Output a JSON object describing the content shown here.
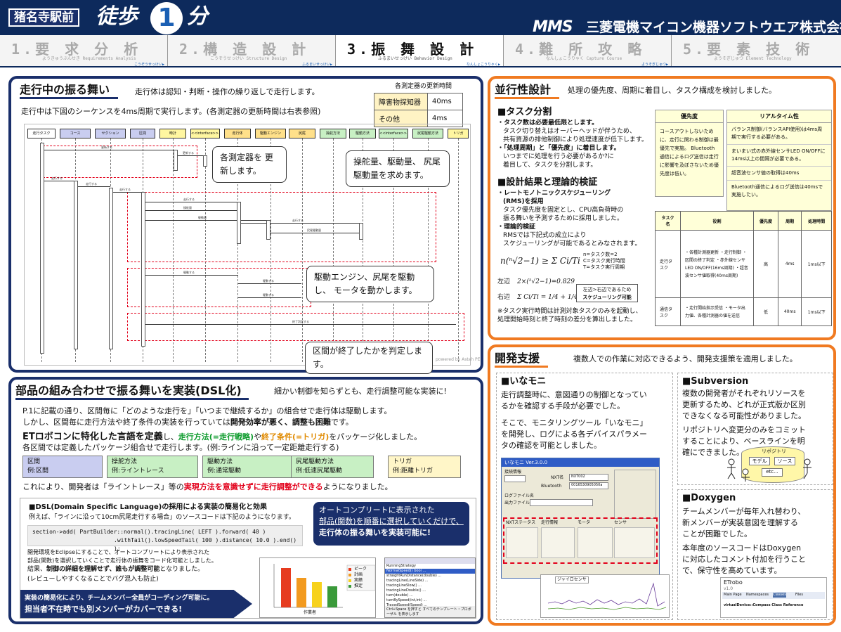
{
  "header": {
    "team": "猪名寺駅前",
    "walk": "徒歩",
    "one": "1",
    "minute": "分",
    "logo": "MMS",
    "company": "三菱電機マイコン機器ソフトウエア株式会社"
  },
  "tabs": [
    {
      "title": "1.要 求 分 析",
      "sub": "ようきゅうぶんせき Requirements Analysis",
      "next": "こうぞうせっけい▶"
    },
    {
      "title": "2.構 造 設 計",
      "sub": "こうぞうせっけい Structure Design",
      "next": "ふるまいせっけい▶"
    },
    {
      "title": "3.振 舞 設 計",
      "sub": "ふるまいせっけい Behavior Design",
      "next": "なんしょこうりゃく▶"
    },
    {
      "title": "4.難 所 攻 略",
      "sub": "なんしょこうりゃく Capture Course",
      "next": "ようそぎじゅつ▶"
    },
    {
      "title": "5.要 素 技 術",
      "sub": "ようそぎじゅつ Element Technology",
      "next": ""
    }
  ],
  "behavior": {
    "title": "走行中の振る舞い",
    "lead": "走行体は認知・判断・操作の繰り返しで走行します。",
    "desc": "走行中は下図のシーケンスを4ms周期で実行します。(各測定器の更新時間は右表参照)",
    "table_title": "各測定器の更新時間",
    "table": [
      [
        "障害物探知器",
        "40ms"
      ],
      [
        "その他",
        "4ms"
      ]
    ],
    "lifelines": [
      "走行タスク",
      "コース",
      "セクション",
      "区間",
      "時計",
      "<<interface>> 測定器",
      "走行体",
      "駆動エンジン",
      "尻尾",
      "操舵方法",
      "駆動方法",
      "<<interface>> 走行書換",
      "尻尾駆動方法",
      "トリガ"
    ],
    "callouts": [
      "各測定器を 更新します。",
      "操舵量、駆動量、 尻尾駆動量を求めます。",
      "駆動エンジン、尻尾を駆動し、 モータを動かします。",
      "区間が終了したかを判定します。"
    ],
    "msgs": [
      "更新する",
      "更新する",
      "走行する",
      "走行する",
      "走行する",
      "走行する",
      "操舵量",
      "駆動量",
      "走行する",
      "尻尾駆動量",
      "駆動する",
      "駆動する",
      "駆動する",
      "終了判定する"
    ],
    "credit": "powered by Astah PE"
  },
  "dsl": {
    "title": "部品の組み合わせで振る舞いを実装(DSL化)",
    "lead": "細かい制御を知らずとも、走行調整可能な実装に!",
    "p1": "P.1に記載の通り、区間毎に「どのような走行を」「いつまで継続するか」の組合せで走行体は駆動します。",
    "p2a": "しかし、区間毎に走行方法や終了条件の実装を行っていては",
    "p2b": "開発効率が悪く、調整も困難",
    "p2c": "です。",
    "p3a": "ETロボコンに特化した言語を定義",
    "p3b": "し、",
    "p3c": "走行方法(=走行戦略)",
    "p3d": "や",
    "p3e": "終了条件(=トリガ)",
    "p3f": "をパッケージ化しました。",
    "p4": "各区間では定義したパッケージ組合せで走行します。(例:ラインに沿って一定距離走行する)",
    "boxes": [
      {
        "a": "区間",
        "b": "例:区間"
      },
      {
        "a": "操舵方法",
        "b": "例:ライントレース"
      },
      {
        "a": "駆動方法",
        "b": "例:通常駆動"
      },
      {
        "a": "尻尾駆動方法",
        "b": "例:低速尻尾駆動"
      },
      {
        "a": "トリガ",
        "b": "例:距離トリガ"
      }
    ],
    "p5a": "これにより、開発者は「ライントレース」等の",
    "p5b": "実現方法を意識せずに走行調整ができる",
    "p5c": "ようになりました。",
    "inner_title": "■DSL(Domain Specific Language)の採用による実装の簡易化と効果",
    "inner_lead": "例えば、「ラインに沿って10cm尻尾走行する場合」のソースコードは下記のようになります。",
    "code1": "section->add( PartBuilder::normal().tracingLine( LEFT ).forward( 40 )",
    "code2": ".withTail().lowSpeedTail( 100 ).distance( 10.0 ).end() );",
    "inner1": "開発環境をEclipseにすることで、オートコンプリートにより表示された",
    "inner2": "部品(関数)を選択していくことで走行体の振舞をコード化可能としました。",
    "inner3a": "結果、",
    "inner3b": "制御の詳細を理解せず、誰もが調整可能",
    "inner3c": "となりました。",
    "inner4": "(レビューしやすくなることでバグ混入も防止)",
    "blue_a": "オートコンプリートに表示された",
    "blue_b": "部品(関数)を順番に選択していくだけで、",
    "blue_c": "走行体の振る舞いを実装可能に!",
    "foot_a": "実装の簡易化により、チームメンバー全員がコーディング可能に。",
    "foot_b": "担当者不在時でも別メンバーがカバーできる!",
    "chart_xlabel": "作業者",
    "chart_vals": [
      "ピーク",
      "計画",
      "実績",
      "推定"
    ],
    "ac_items": [
      "RunningStrategy",
      "NormalSpeed() bool ...",
      "straightRunDistance(double) ...",
      "tracingLine(LineSide) ...",
      "tracingLineSlow() ...",
      "tracingLineDouble() ...",
      "turn(double) ...",
      "turnBySpeed(int,int) ...",
      "TracedSpeed(Speed) ..."
    ],
    "ac_footer": "Ctrl+Space を押すと すべてのテンプレート・プロポーザル を表示します"
  },
  "parallel": {
    "title": "並行性設計",
    "lead": "処理の優先度、周期に着目し、タスク構成を検討しました。",
    "h1": "■タスク分割",
    "l1": "・タスク数は必要最低限とします。",
    "l2": "タスク切り替えはオーバーヘッドが伴うため、",
    "l3": "共有資源の排他制御により処理速度が低下します。",
    "l4": "・「処理周期」と「優先度」に着目します。",
    "l5": "いつまでに処理を行う必要があるか?に",
    "l6": "着目して、タスクを分割します。",
    "h2": "■設計結果と理論的検証",
    "m1": "・レートモノトニックスケジューリング",
    "m2": "(RMS)を採用",
    "m3": "タスク優先度を固定とし、CPU高負荷時の",
    "m4": "振る舞いを予測するために採用しました。",
    "m5": "・理論的検証",
    "m6": "RMSでは下記式の成立により",
    "m7": "スケジューリングが可能であるとみなされます。",
    "formula": "n(ⁿ√2−1) ≥ Σ Ci/Ti",
    "legend1": "n=タスク数=2",
    "legend2": "C=タスク実行時間",
    "legend3": "T=タスク実行周期",
    "left_label": "左辺",
    "left_val": "2×(²√2−1)=0.829",
    "right_label": "右辺",
    "right_val": "Σ Ci/Ti = 1/4 + 1/40 = 0.275",
    "result_a": "左辺>右辺であるため",
    "result_b": "スケジューリング可能",
    "note1": "※タスク実行時間は計測対象タスクのみを起動し、",
    "note2": "処理開始時刻と終了時刻の差分を算出しました。",
    "prio_head": "優先度",
    "prio_text": "コースアウトしないために、走行に関わる制御は最優先で実施。 Bluetooth通信によるログ送信は走行に影響を及ぼさないため優先度は低い。",
    "rt_head": "リアルタイム性",
    "rt1": "バランス制御(バランスAPI使用)は4ms周期で実行する必要がある。",
    "rt2": "まいまい式の赤外線センサLED ON/OFFに14ms以上の間隔が必要である。",
    "rt3": "超音波センサ値の取得は40ms",
    "rt4": "Bluetooth通信によるログ送信は40msで実施したい。",
    "task_cols": [
      "タスク名",
      "役割",
      "優先度",
      "周期",
      "処理時間"
    ],
    "task_rows": [
      {
        "name": "走行タスク",
        "role": "・各種計測器更新 ・走行制御 ・区間の終了判定 ・赤外線センサLED ON/OFF(16ms周期) ・超音波センサ値取得(40ms周期)",
        "prio": "高",
        "period": "4ms",
        "time": "1ms以下"
      },
      {
        "name": "通信タスク",
        "role": "・走行開始指示受信 ・モータ出力値、各種計測器の値を送信",
        "prio": "低",
        "period": "40ms",
        "time": "1ms以下"
      }
    ]
  },
  "dev": {
    "title": "開発支援",
    "lead": "複数人での作業に対応できるよう、開発支援策を適用しました。",
    "inamoni_h": "■いなモニ",
    "in1": "走行調整時に、意図通りの制御となってい",
    "in2": "るかを確認する手段が必要でした。",
    "in3": "そこで、モニタリングツール「いなモニ」",
    "in4": "を開発し、ログによる各デバイスパラメー",
    "in5": "タの確認を可能としました。",
    "win_title": "いなモニ Ver.3.0.0",
    "win_fields": [
      "接続情報",
      "NXT名",
      "NXT002",
      "Bluetooth",
      "0016530905050a",
      "ログファイル名",
      "出力ファイル名",
      "NXTステータス",
      "走行情報",
      "モータ",
      "センサ"
    ],
    "graph_label": "ジャイロセンサ",
    "svn_h": "■Subversion",
    "sv1": "複数の開発者がそれぞれリソースを",
    "sv2": "更新するため、どれが正式版か区別",
    "sv3": "できなくなる可能性がありました。",
    "sv4": "リポジトリへ変更分のみをコミット",
    "sv5": "することにより、ベースラインを明",
    "sv6": "確にできました。",
    "repo": "リポジトリ",
    "model": "モデル",
    "source": "ソース",
    "etc": "etc...",
    "dox_h": "■Doxygen",
    "dx1": "チームメンバーが毎年入れ替わり、",
    "dx2": "新メンバーが実装意図を理解する",
    "dx3": "ことが困難でした。",
    "dx4": "本年度のソースコードはDoxygen",
    "dx5": "に対応したコメント付加を行うこと",
    "dx6": "で、保守性を高めています。",
    "dox_app": "ETrobo",
    "dox_ver": "v1.0",
    "dox_tabs": [
      "Main Page",
      "Namespaces",
      "Classes",
      "Files"
    ],
    "dox_class": "virtualDevice::Compass Class Reference"
  }
}
